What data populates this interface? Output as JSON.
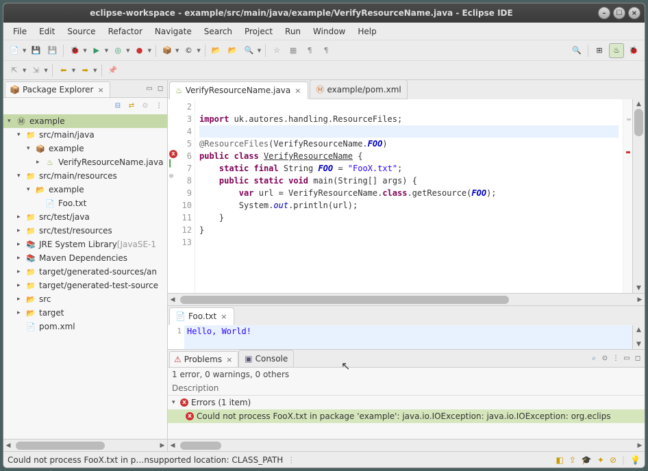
{
  "window": {
    "title": "eclipse-workspace - example/src/main/java/example/VerifyResourceName.java - Eclipse IDE"
  },
  "menubar": [
    "File",
    "Edit",
    "Source",
    "Refactor",
    "Navigate",
    "Search",
    "Project",
    "Run",
    "Window",
    "Help"
  ],
  "sidebar": {
    "title": "Package Explorer",
    "project": "example",
    "nodes": {
      "src_main_java": "src/main/java",
      "pkg_example": "example",
      "java_file": "VerifyResourceName.java",
      "src_main_resources": "src/main/resources",
      "res_pkg_example": "example",
      "res_file": "Foo.txt",
      "src_test_java": "src/test/java",
      "src_test_resources": "src/test/resources",
      "jre": "JRE System Library",
      "jre_dec": "[JavaSE-1",
      "maven": "Maven Dependencies",
      "target_gen_src": "target/generated-sources/an",
      "target_gen_test": "target/generated-test-source",
      "src_folder": "src",
      "target_folder": "target",
      "pom": "pom.xml"
    }
  },
  "editor": {
    "tabs": {
      "t1": "VerifyResourceName.java",
      "t2": "example/pom.xml"
    },
    "gutter": [
      "2",
      "3",
      "4",
      "5",
      "6",
      "7",
      "8",
      "9",
      "10",
      "11",
      "12",
      "13"
    ],
    "imports": "import uk.autores.handling.ResourceFiles;",
    "annotation_full": "@ResourceFiles(VerifyResourceName.FOO)",
    "line7": "    static final String FOO = \"FooX.txt\";",
    "line8": "    public static void main(String[] args) {",
    "line9": "        var url = VerifyResourceName.class.getResource(FOO);",
    "line10": "        System.out.println(url);",
    "line11": "    }",
    "line12": "}"
  },
  "secondary_editor": {
    "tab": "Foo.txt",
    "line_no": "1",
    "content": "Hello, World!"
  },
  "problems": {
    "tab1": "Problems",
    "tab2": "Console",
    "summary": "1 error, 0 warnings, 0 others",
    "col1": "Description",
    "group": "Errors (1 item)",
    "error": "Could not process FooX.txt in package 'example': java.io.IOException: java.io.IOException: org.eclips"
  },
  "statusbar": {
    "msg": "Could not process FooX.txt in p…nsupported location: CLASS_PATH"
  }
}
